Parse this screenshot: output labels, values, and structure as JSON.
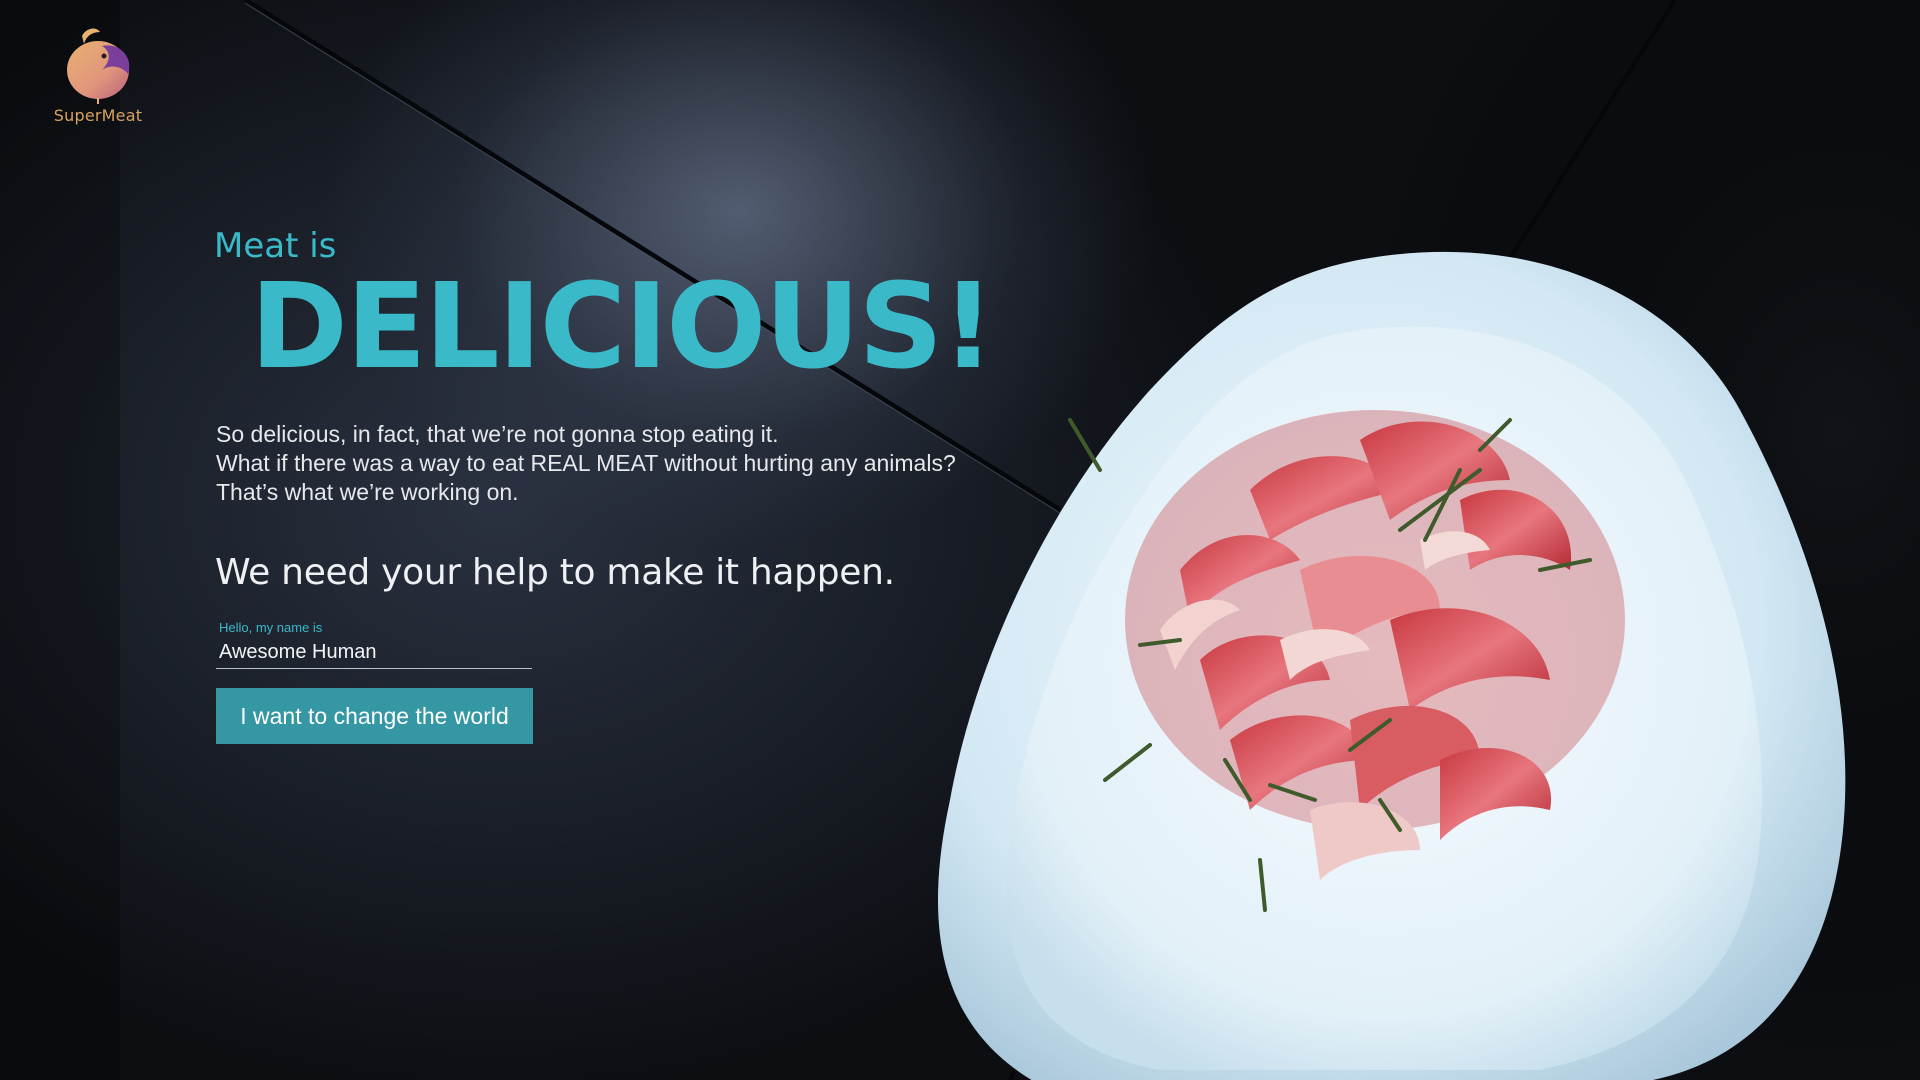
{
  "brand": {
    "name": "SuperMeat",
    "logo_icon": "chick-logo-icon",
    "colors": {
      "gold": "#d9a15e",
      "purple": "#7a3f9a",
      "peach": "#e8a585"
    }
  },
  "hero": {
    "eyebrow": "Meat is",
    "headline": "DELICIOUS!",
    "description_lines": [
      "So delicious, in fact, that we’re not gonna stop eating it.",
      "What if there was a way to eat REAL MEAT without hurting any animals?",
      "That’s what we’re working on."
    ],
    "cta_heading": "We need your help to make it happen."
  },
  "form": {
    "name_label": "Hello, my name is",
    "name_value": "Awesome Human",
    "submit_label": "I want to change the world"
  },
  "theme": {
    "accent": "#3ab9c9",
    "button": "#3497a3",
    "background": "#0d1015",
    "plate": "#dbeef8"
  },
  "image": {
    "subject": "bacon-plate-image"
  }
}
